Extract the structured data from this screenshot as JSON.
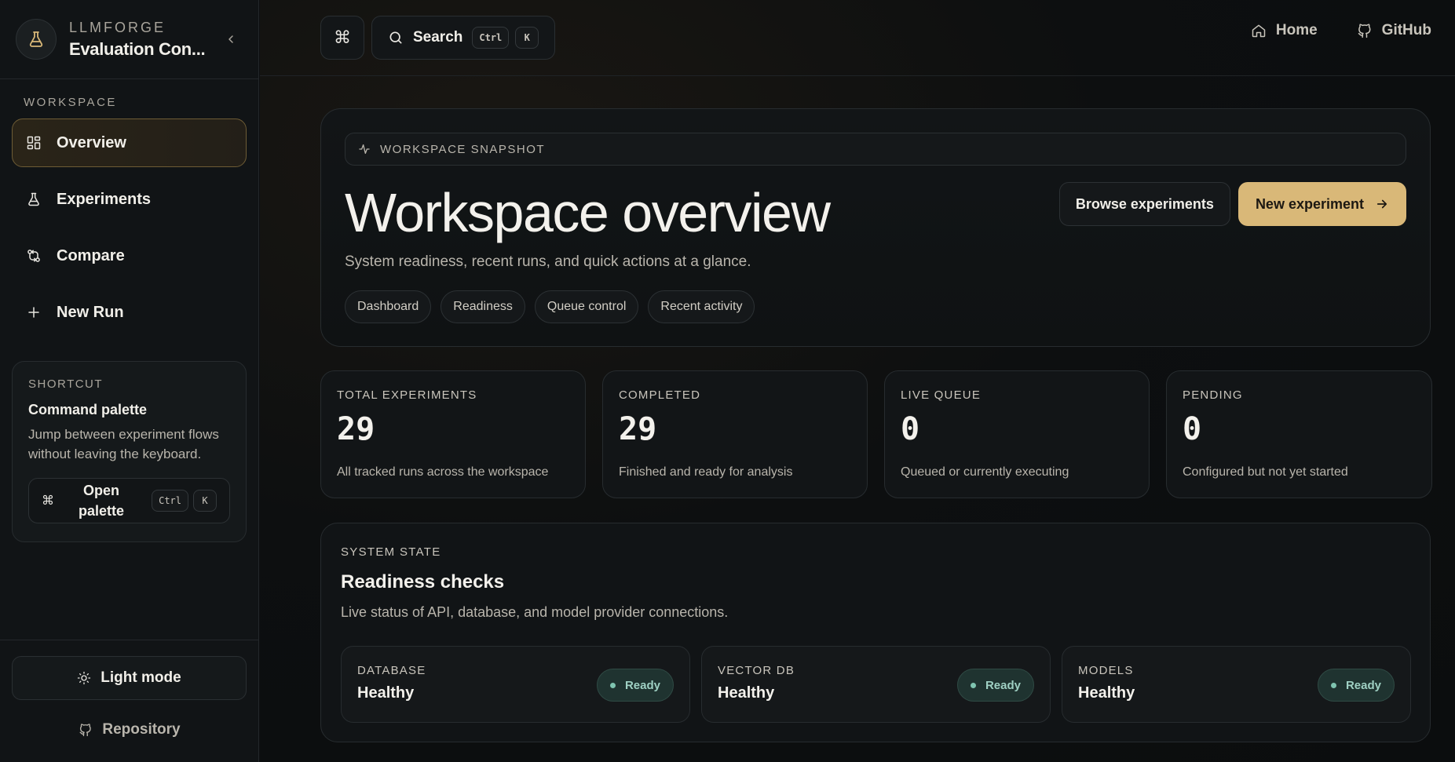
{
  "brand": {
    "kicker": "LLMFORGE",
    "title": "Evaluation Con..."
  },
  "sidebar": {
    "section_label": "WORKSPACE",
    "items": [
      {
        "label": "Overview",
        "icon": "grid-icon",
        "active": true
      },
      {
        "label": "Experiments",
        "icon": "flask-icon",
        "active": false
      },
      {
        "label": "Compare",
        "icon": "compare-icon",
        "active": false
      },
      {
        "label": "New Run",
        "icon": "plus-icon",
        "active": false
      }
    ],
    "shortcut": {
      "kicker": "SHORTCUT",
      "title": "Command palette",
      "description": "Jump between experiment flows without leaving the keyboard.",
      "button_label": "Open palette",
      "keys": [
        "Ctrl",
        "K"
      ]
    },
    "footer": {
      "light_mode_label": "Light mode",
      "repository_label": "Repository"
    }
  },
  "topbar": {
    "command_icon": "command-icon",
    "search_label": "Search",
    "search_keys": [
      "Ctrl",
      "K"
    ],
    "links": [
      {
        "label": "Home",
        "icon": "home-icon"
      },
      {
        "label": "GitHub",
        "icon": "github-icon"
      }
    ]
  },
  "hero": {
    "snapshot_label": "WORKSPACE SNAPSHOT",
    "title": "Workspace overview",
    "subtitle": "System readiness, recent runs, and quick actions at a glance.",
    "chips": [
      "Dashboard",
      "Readiness",
      "Queue control",
      "Recent activity"
    ],
    "browse_label": "Browse experiments",
    "new_label": "New experiment"
  },
  "stats": [
    {
      "label": "TOTAL EXPERIMENTS",
      "value": "29",
      "description": "All tracked runs across the workspace"
    },
    {
      "label": "COMPLETED",
      "value": "29",
      "description": "Finished and ready for analysis"
    },
    {
      "label": "LIVE QUEUE",
      "value": "0",
      "description": "Queued or currently executing"
    },
    {
      "label": "PENDING",
      "value": "0",
      "description": "Configured but not yet started"
    }
  ],
  "readiness": {
    "kicker": "SYSTEM STATE",
    "title": "Readiness checks",
    "subtitle": "Live status of API, database, and model provider connections.",
    "checks": [
      {
        "label": "DATABASE",
        "value": "Healthy",
        "status": "Ready"
      },
      {
        "label": "VECTOR DB",
        "value": "Healthy",
        "status": "Ready"
      },
      {
        "label": "MODELS",
        "value": "Healthy",
        "status": "Ready"
      }
    ]
  },
  "colors": {
    "accent": "#d9b878",
    "ready": "#7fc4b0",
    "background": "#0c0e10"
  }
}
